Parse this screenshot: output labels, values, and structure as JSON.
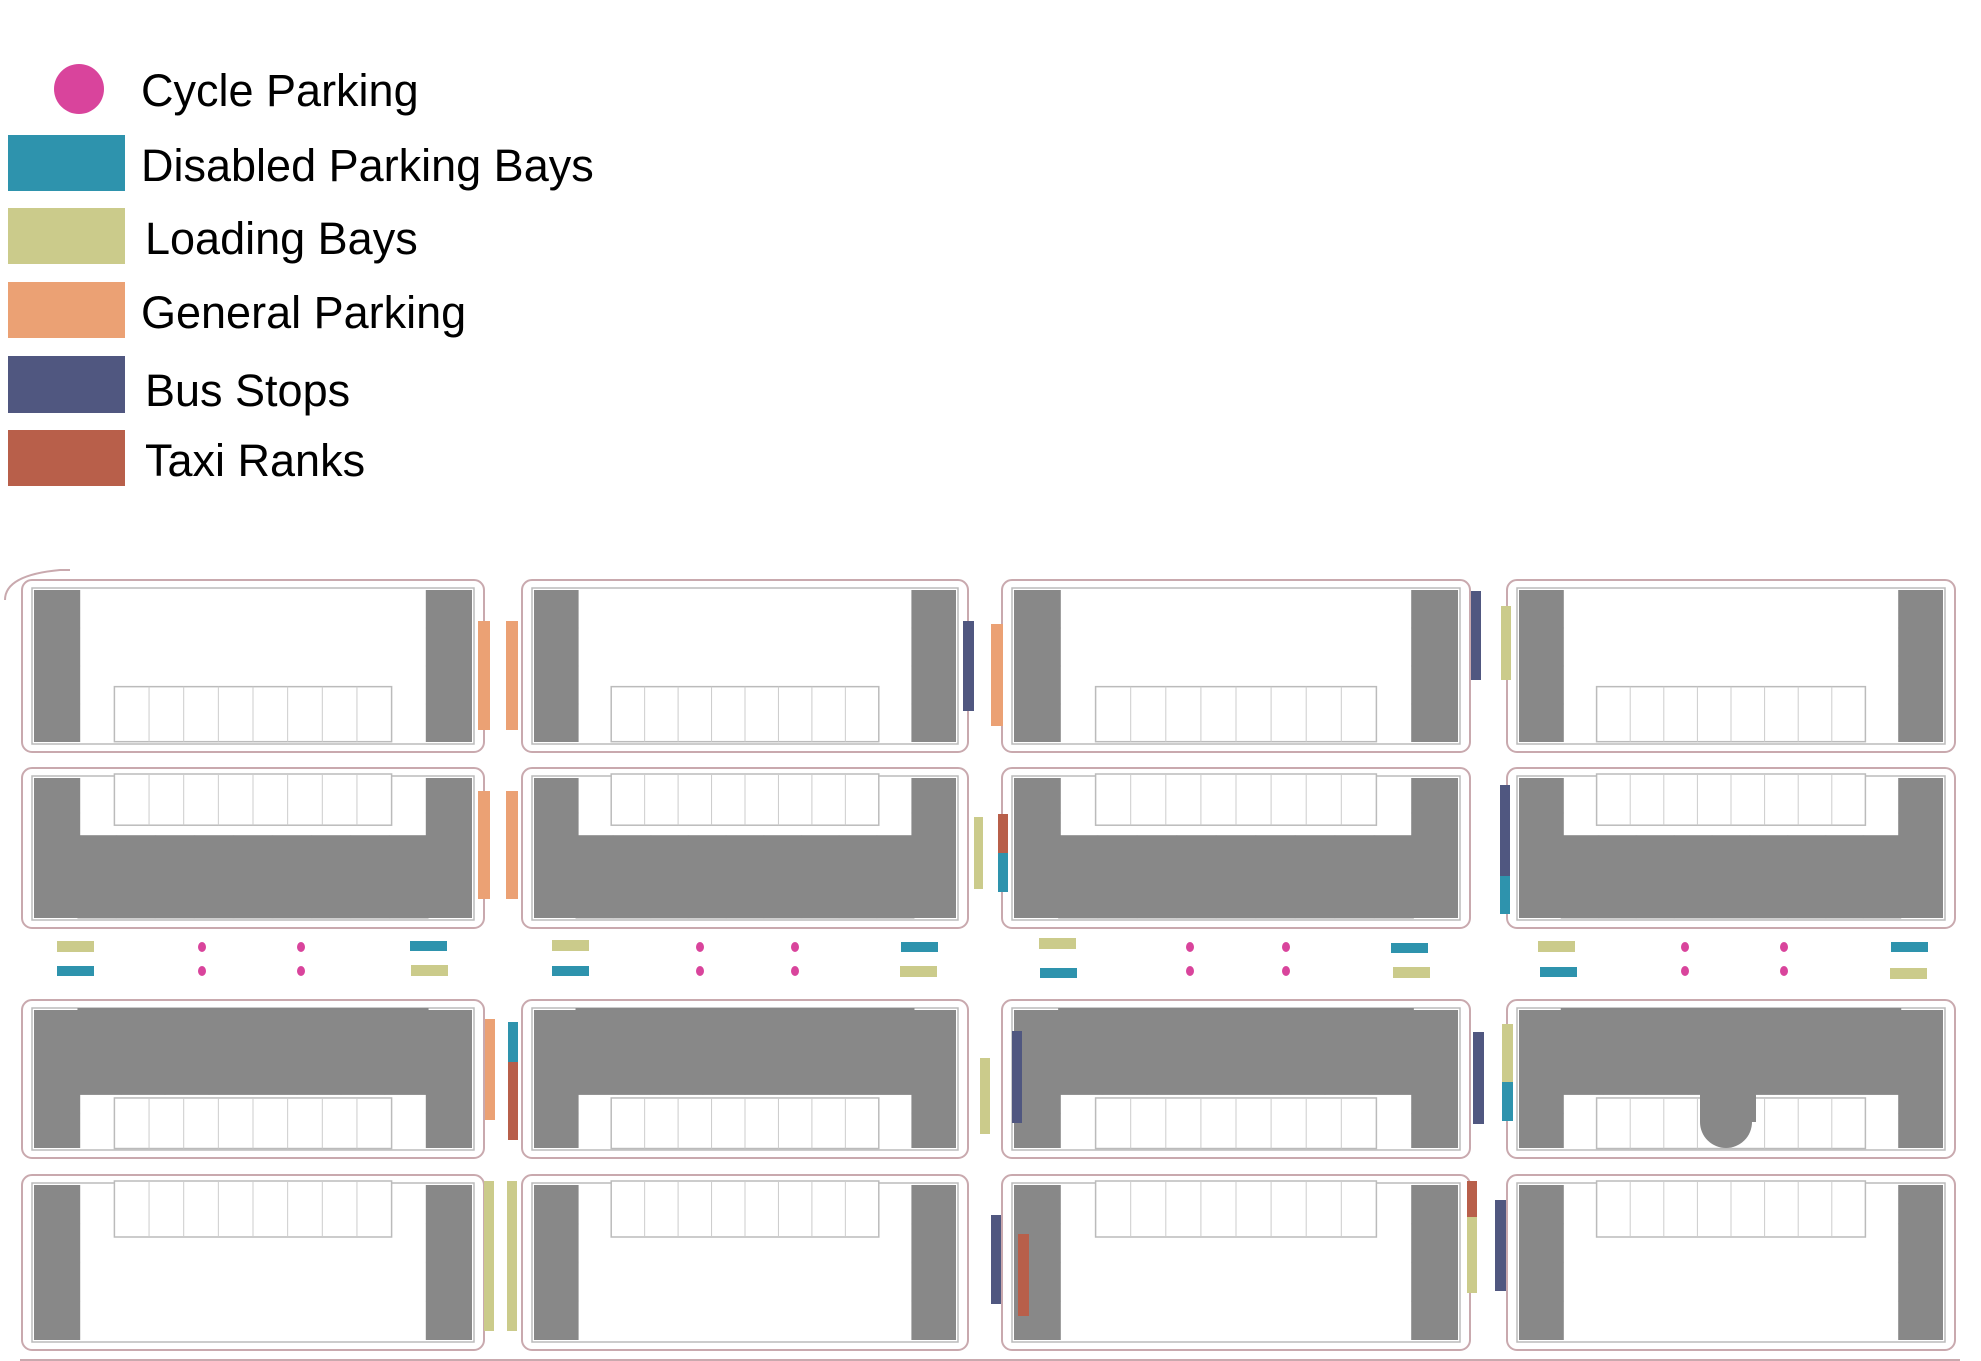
{
  "legend": {
    "items": [
      {
        "key": "cycle",
        "label": "Cycle Parking",
        "shape": "circle",
        "color": "#D9449C"
      },
      {
        "key": "disabled",
        "label": "Disabled Parking Bays",
        "shape": "rect",
        "color": "#2E93AD"
      },
      {
        "key": "loading",
        "label": "Loading Bays",
        "shape": "rect",
        "color": "#CBCB8B"
      },
      {
        "key": "general",
        "label": "General Parking",
        "shape": "rect",
        "color": "#EBA174"
      },
      {
        "key": "bus",
        "label": "Bus Stops",
        "shape": "rect",
        "color": "#505780"
      },
      {
        "key": "taxi",
        "label": "Taxi Ranks",
        "shape": "rect",
        "color": "#B85F4A"
      }
    ]
  },
  "map": {
    "building_color": "#888888",
    "outline_color": "#C9A9AE",
    "block_columns": 4,
    "block_rows_per_column": 4,
    "main_road_markers_per_block": {
      "cycle_parking": 4,
      "disabled_parking_bays": 2,
      "loading_bays": 2
    },
    "marker_counts": {
      "cycle_parking": 16,
      "disabled_parking_bays": 12,
      "loading_bays": 14,
      "general_parking": 6,
      "bus_stops": 8,
      "taxi_ranks": 5
    }
  }
}
